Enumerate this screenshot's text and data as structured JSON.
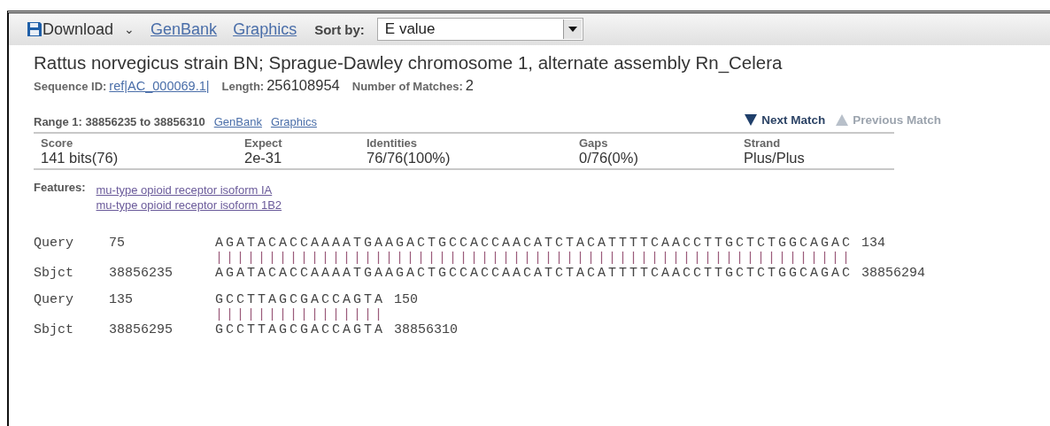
{
  "toolbar": {
    "download": {
      "label": "Download",
      "caret": "⌄"
    },
    "links": [
      "GenBank",
      "Graphics"
    ],
    "sort": {
      "label": "Sort by:",
      "value": "E value"
    }
  },
  "hit": {
    "title": "Rattus norvegicus strain BN; Sprague-Dawley chromosome 1, alternate assembly Rn_Celera",
    "meta": [
      {
        "label": "Sequence ID:",
        "value": "ref|AC_000069.1|",
        "kind": "link"
      },
      {
        "label": "Length:",
        "value": "256108954",
        "kind": "text"
      },
      {
        "label": "Number of Matches:",
        "value": "2",
        "kind": "text"
      }
    ]
  },
  "range": {
    "label": "Range 1: 38856235 to 38856310",
    "links": [
      "GenBank",
      "Graphics"
    ],
    "nav": [
      {
        "label": "Next Match",
        "kind": "down",
        "disabled": false
      },
      {
        "label": "Previous Match",
        "kind": "up",
        "disabled": true
      }
    ]
  },
  "stats": {
    "columns": [
      {
        "header": "Score",
        "value": "141 bits(76)"
      },
      {
        "header": "Expect",
        "value": "2e-31"
      },
      {
        "header": "Identities",
        "value": "76/76(100%)"
      },
      {
        "header": "Gaps",
        "value": "0/76(0%)"
      },
      {
        "header": "Strand",
        "value": "Plus/Plus"
      }
    ]
  },
  "features": {
    "label": "Features:",
    "links": [
      "mu-type opioid receptor isoform IA",
      "mu-type opioid receptor isoform 1B2"
    ]
  },
  "alignment": [
    {
      "query": {
        "label": "Query",
        "start": "75",
        "seq": "AGATACACCAAAATGAAGACTGCCACCAACATCTACATTTTCAACCTTGCTCTGGCAGAC",
        "end": "134"
      },
      "match": "||||||||||||||||||||||||||||||||||||||||||||||||||||||||||||",
      "sbjct": {
        "label": "Sbjct",
        "start": "38856235",
        "seq": "AGATACACCAAAATGAAGACTGCCACCAACATCTACATTTTCAACCTTGCTCTGGCAGAC",
        "end": "38856294"
      }
    },
    {
      "query": {
        "label": "Query",
        "start": "135",
        "seq": "GCCTTAGCGACCAGTA",
        "end": "150"
      },
      "match": "||||||||||||||||",
      "sbjct": {
        "label": "Sbjct",
        "start": "38856295",
        "seq": "GCCTTAGCGACCAGTA",
        "end": "38856310"
      }
    }
  ]
}
